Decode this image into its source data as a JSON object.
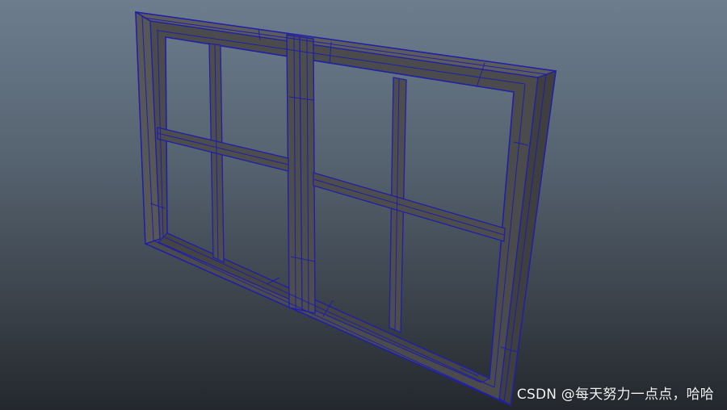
{
  "viewport": {
    "background_top": "#6d7d8e",
    "background_bottom": "#24282d"
  },
  "model": {
    "face_color": "#4a4a4a",
    "top_face_color": "#5a5a5a",
    "wire_color": "#1f1fa8"
  },
  "watermark": {
    "text": "CSDN @每天努力一点点，哈哈"
  }
}
